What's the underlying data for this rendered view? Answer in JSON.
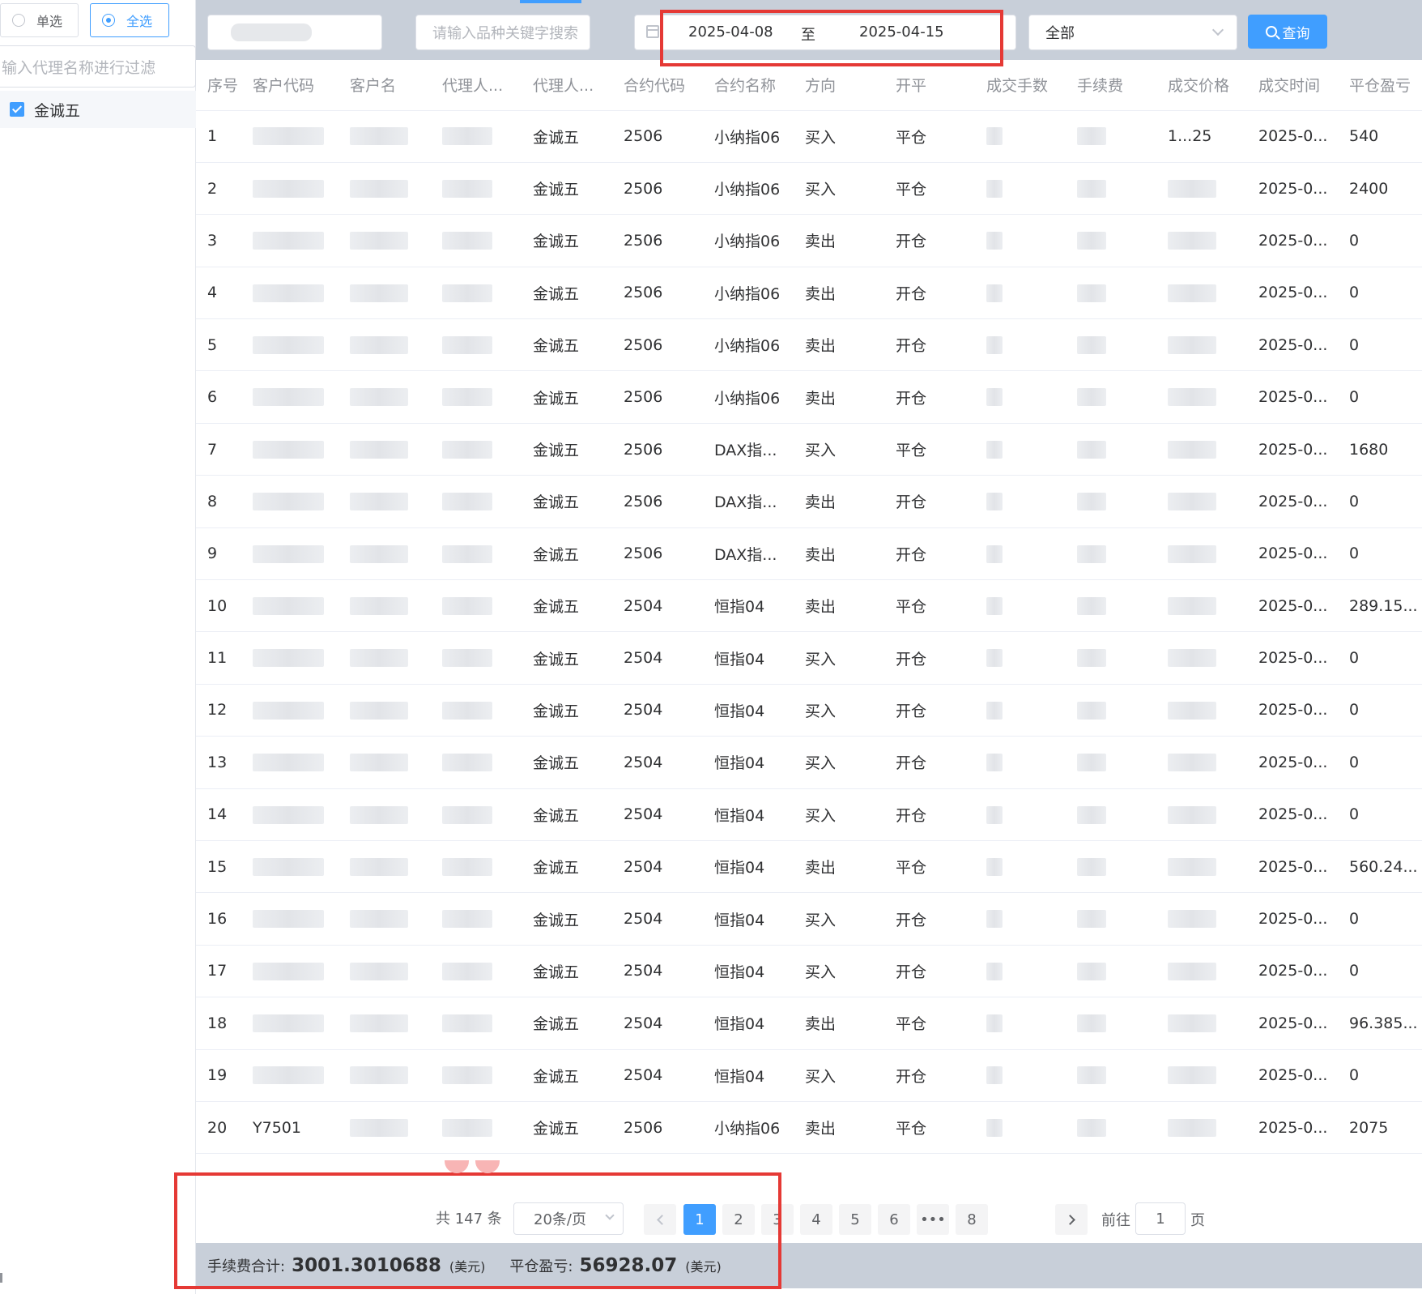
{
  "left_panel": {
    "radio_single": "单选",
    "radio_all": "全选",
    "filter_placeholder": "输入代理名称进行过滤",
    "agent_item": "金诚五"
  },
  "toolbar": {
    "keyword_placeholder": "请输入品种关键字搜索",
    "date_start": "2025-04-08",
    "date_sep": "至",
    "date_end": "2025-04-15",
    "select_value": "全部",
    "query_label": "查询"
  },
  "table": {
    "columns": [
      "序号",
      "客户代码",
      "客户名",
      "代理人...",
      "代理人...",
      "合约代码",
      "合约名称",
      "方向",
      "开平",
      "成交手数",
      "手续费",
      "成交价格",
      "成交时间",
      "平仓盈亏"
    ],
    "rows": [
      {
        "no": "1",
        "agent": "金诚五",
        "code": "2506",
        "name": "小纳指06",
        "dir": "买入",
        "oc": "平仓",
        "price": "1...25",
        "time": "2025-0...",
        "pnl": "540"
      },
      {
        "no": "2",
        "agent": "金诚五",
        "code": "2506",
        "name": "小纳指06",
        "dir": "买入",
        "oc": "平仓",
        "price": "",
        "time": "2025-0...",
        "pnl": "2400"
      },
      {
        "no": "3",
        "agent": "金诚五",
        "code": "2506",
        "name": "小纳指06",
        "dir": "卖出",
        "oc": "开仓",
        "price": "",
        "time": "2025-0...",
        "pnl": "0"
      },
      {
        "no": "4",
        "agent": "金诚五",
        "code": "2506",
        "name": "小纳指06",
        "dir": "卖出",
        "oc": "开仓",
        "price": "",
        "time": "2025-0...",
        "pnl": "0"
      },
      {
        "no": "5",
        "agent": "金诚五",
        "code": "2506",
        "name": "小纳指06",
        "dir": "卖出",
        "oc": "开仓",
        "price": "",
        "time": "2025-0...",
        "pnl": "0"
      },
      {
        "no": "6",
        "agent": "金诚五",
        "code": "2506",
        "name": "小纳指06",
        "dir": "卖出",
        "oc": "开仓",
        "price": "",
        "time": "2025-0...",
        "pnl": "0"
      },
      {
        "no": "7",
        "agent": "金诚五",
        "code": "2506",
        "name": "DAX指...",
        "dir": "买入",
        "oc": "平仓",
        "price": "",
        "time": "2025-0...",
        "pnl": "1680"
      },
      {
        "no": "8",
        "agent": "金诚五",
        "code": "2506",
        "name": "DAX指...",
        "dir": "卖出",
        "oc": "开仓",
        "price": "",
        "time": "2025-0...",
        "pnl": "0"
      },
      {
        "no": "9",
        "agent": "金诚五",
        "code": "2506",
        "name": "DAX指...",
        "dir": "卖出",
        "oc": "开仓",
        "price": "",
        "time": "2025-0...",
        "pnl": "0"
      },
      {
        "no": "10",
        "agent": "金诚五",
        "code": "2504",
        "name": "恒指04",
        "dir": "卖出",
        "oc": "平仓",
        "price": "",
        "time": "2025-0...",
        "pnl": "289.15..."
      },
      {
        "no": "11",
        "agent": "金诚五",
        "code": "2504",
        "name": "恒指04",
        "dir": "买入",
        "oc": "开仓",
        "price": "",
        "time": "2025-0...",
        "pnl": "0"
      },
      {
        "no": "12",
        "agent": "金诚五",
        "code": "2504",
        "name": "恒指04",
        "dir": "买入",
        "oc": "开仓",
        "price": "",
        "time": "2025-0...",
        "pnl": "0"
      },
      {
        "no": "13",
        "agent": "金诚五",
        "code": "2504",
        "name": "恒指04",
        "dir": "买入",
        "oc": "开仓",
        "price": "",
        "time": "2025-0...",
        "pnl": "0"
      },
      {
        "no": "14",
        "agent": "金诚五",
        "code": "2504",
        "name": "恒指04",
        "dir": "买入",
        "oc": "开仓",
        "price": "",
        "time": "2025-0...",
        "pnl": "0"
      },
      {
        "no": "15",
        "agent": "金诚五",
        "code": "2504",
        "name": "恒指04",
        "dir": "卖出",
        "oc": "平仓",
        "price": "",
        "time": "2025-0...",
        "pnl": "560.24..."
      },
      {
        "no": "16",
        "agent": "金诚五",
        "code": "2504",
        "name": "恒指04",
        "dir": "买入",
        "oc": "开仓",
        "price": "",
        "time": "2025-0...",
        "pnl": "0"
      },
      {
        "no": "17",
        "agent": "金诚五",
        "code": "2504",
        "name": "恒指04",
        "dir": "买入",
        "oc": "开仓",
        "price": "",
        "time": "2025-0...",
        "pnl": "0"
      },
      {
        "no": "18",
        "agent": "金诚五",
        "code": "2504",
        "name": "恒指04",
        "dir": "卖出",
        "oc": "平仓",
        "price": "",
        "time": "2025-0...",
        "pnl": "96.385..."
      },
      {
        "no": "19",
        "agent": "金诚五",
        "code": "2504",
        "name": "恒指04",
        "dir": "买入",
        "oc": "开仓",
        "price": "",
        "time": "2025-0...",
        "pnl": "0"
      },
      {
        "no": "20",
        "cust": "Y7501",
        "agent": "金诚五",
        "code": "2506",
        "name": "小纳指06",
        "dir": "卖出",
        "oc": "平仓",
        "price": "",
        "time": "2025-0...",
        "pnl": "2075"
      }
    ]
  },
  "pagination": {
    "total": "共 147 条",
    "page_size": "20条/页",
    "pages": [
      "1",
      "2",
      "3",
      "4",
      "5",
      "6",
      "•••",
      "8"
    ],
    "active": "1",
    "goto_label": "前往",
    "goto_value": "1",
    "goto_suffix": "页"
  },
  "summary": {
    "fee_label": "手续费合计:",
    "fee_value": "3001.3010688",
    "fee_unit": "(美元)",
    "pnl_label": "平仓盈亏:",
    "pnl_value": "56928.07",
    "pnl_unit": "(美元)"
  },
  "colors": {
    "accent": "#409eff",
    "toolbar_bg": "#c8cfd9",
    "annotation_red": "#e53935"
  }
}
